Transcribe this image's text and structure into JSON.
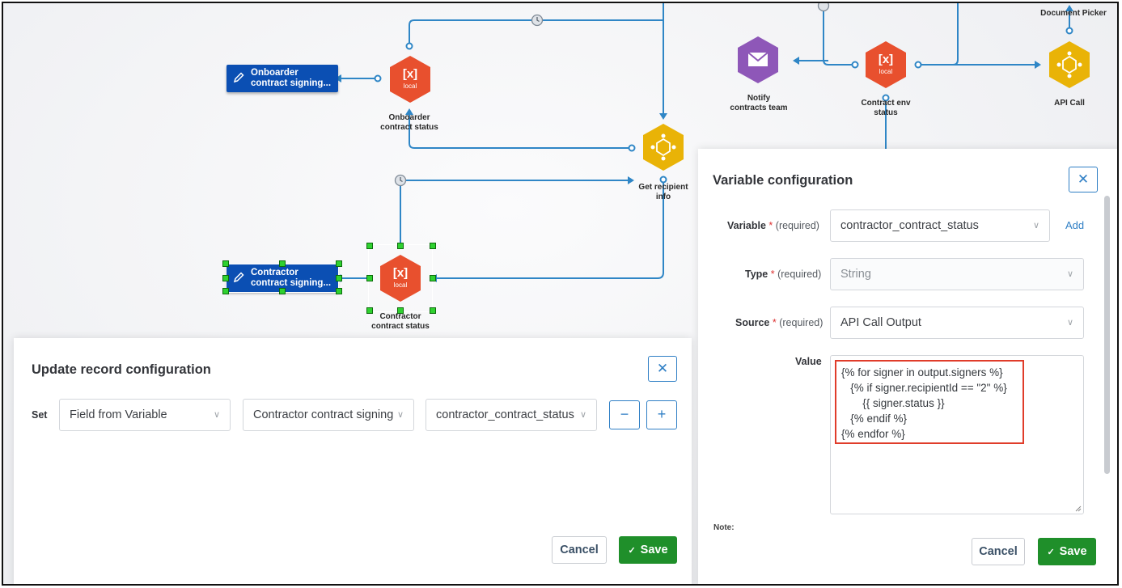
{
  "canvas": {
    "nodes": {
      "onboarder_status": {
        "icon": "[x]",
        "sub": "local",
        "label": "Onboarder\ncontract status"
      },
      "contractor_status": {
        "icon": "[x]",
        "sub": "local",
        "label": "Contractor\ncontract status"
      },
      "get_recipient": {
        "label": "Get recipient\ninfo"
      },
      "notify": {
        "label": "Notify\ncontracts team"
      },
      "contract_env": {
        "icon": "[x]",
        "sub": "local",
        "label": "Contract env\nstatus"
      },
      "api_call": {
        "label": "API Call"
      },
      "document_picker": {
        "label": "Document Picker"
      }
    },
    "cards": {
      "onboarder": "Onboarder\ncontract signing...",
      "contractor": "Contractor\ncontract signing..."
    },
    "colors": {
      "wire": "#2f86c6",
      "hex_red": "#e8502e",
      "hex_yellow": "#e9b307",
      "hex_purple": "#8e57b8",
      "card_blue": "#0b4fb3"
    }
  },
  "update_panel": {
    "title": "Update record configuration",
    "set_label": "Set",
    "select1": "Field from Variable",
    "select2": "Contractor contract signing",
    "select3": "contractor_contract_status",
    "minus": "−",
    "plus": "+",
    "cancel": "Cancel",
    "save": "Save"
  },
  "variable_panel": {
    "title": "Variable configuration",
    "variable_label": "Variable",
    "type_label": "Type",
    "source_label": "Source",
    "required_note": "(required)",
    "value_label": "Value",
    "note_label": "Note:",
    "variable_value": "contractor_contract_status",
    "add": "Add",
    "type_value": "String",
    "source_value": "API Call Output",
    "code": "{% for signer in output.signers %}\n   {% if signer.recipientId == \"2\" %}\n       {{ signer.status }}\n   {% endif %}\n{% endfor %}",
    "cancel": "Cancel",
    "save": "Save"
  },
  "icons": [
    "pencil-icon",
    "clock-icon",
    "envelope-icon",
    "api-icon",
    "close-icon",
    "chevron-down-icon",
    "check-icon"
  ]
}
